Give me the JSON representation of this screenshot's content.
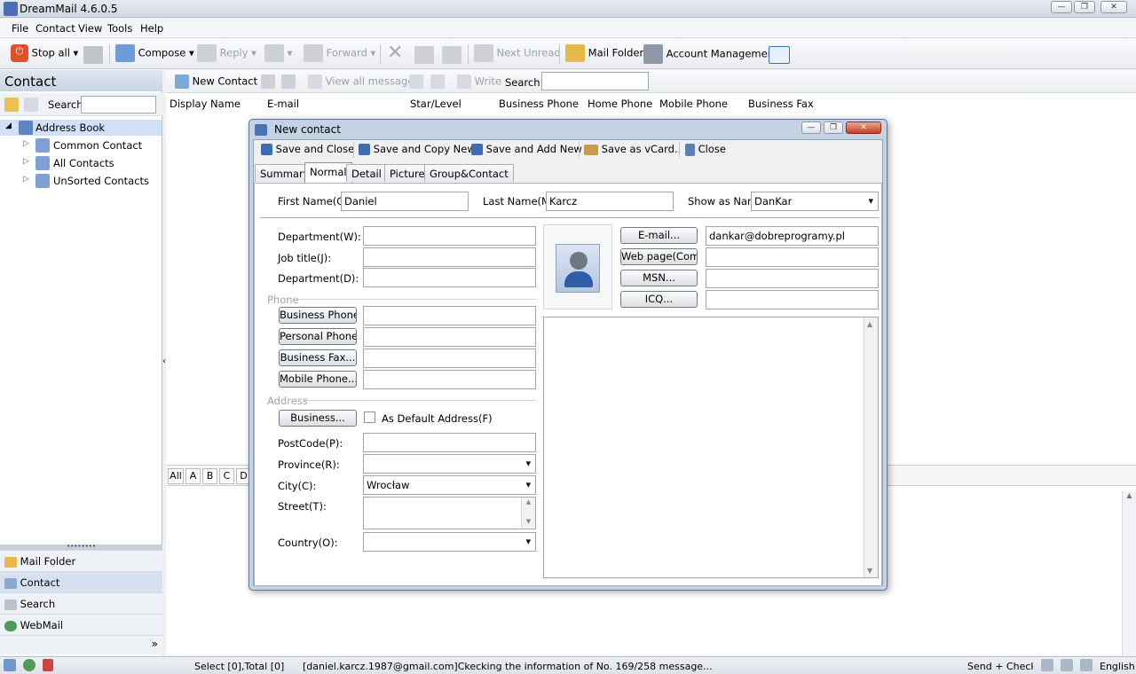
{
  "app": {
    "title": "DreamMail 4.6.0.5"
  },
  "menu": [
    "File",
    "Contact",
    "View",
    "Tools",
    "Help"
  ],
  "toolbar": {
    "stop_all": "Stop all",
    "compose": "Compose",
    "reply": "Reply",
    "forward": "Forward",
    "next_unread": "Next Unread",
    "mail_folder": "Mail Folder",
    "account_management": "Account Management"
  },
  "sidebar": {
    "title": "Contact",
    "search_label": "Search",
    "search_value": "",
    "tree": {
      "root": "Address Book",
      "items": [
        "Common Contact",
        "All Contacts",
        "UnSorted Contacts"
      ]
    },
    "nav": [
      "Mail Folder",
      "Contact",
      "Search",
      "WebMail"
    ]
  },
  "contacts_toolbar": {
    "new_contact": "New Contact",
    "view_all": "View all messages",
    "write": "Write",
    "search_label": "Search:",
    "search_value": ""
  },
  "columns": [
    "Display Name",
    "E-mail",
    "Star/Level",
    "Business Phone",
    "Home Phone",
    "Mobile Phone",
    "Business Fax"
  ],
  "alpha_tabs": [
    "All",
    "A",
    "B",
    "C",
    "D"
  ],
  "status": {
    "count": "Select [0],Total [0]",
    "message": "[daniel.karcz.1987@gmail.com]Ckecking the information of No. 169/258 message...",
    "send_check": "Send + Check..",
    "language": "English"
  },
  "dialog": {
    "title": "New contact",
    "buttons": {
      "save_close": "Save and Close",
      "save_copy_new": "Save and Copy New",
      "save_add_new": "Save and Add New",
      "save_vcard": "Save as vCard..",
      "close": "Close"
    },
    "tabs": [
      "Summary",
      "Normal",
      "Detail",
      "Picture",
      "Group&Contact"
    ],
    "first_name_label": "First Name(G)",
    "first_name": "Daniel",
    "last_name_label": "Last Name(M)",
    "last_name": "Karcz",
    "show_as_label": "Show as Name",
    "show_as": "DanKar",
    "department_w_label": "Department(W):",
    "department_w": "",
    "job_title_label": "Job title(J):",
    "job_title": "",
    "department_d_label": "Department(D):",
    "department_d": "",
    "phone_section": "Phone",
    "phone_buttons": [
      "Business Phone..",
      "Personal Phone..",
      "Business Fax...",
      "Mobile Phone..."
    ],
    "address_section": "Address",
    "business_btn": "Business...",
    "default_address_label": "As Default Address(F)",
    "default_address_checked": false,
    "postcode_label": "PostCode(P):",
    "postcode": "",
    "province_label": "Province(R):",
    "province": "",
    "city_label": "City(C):",
    "city": "Wrocław",
    "street_label": "Street(T):",
    "street": "",
    "country_label": "Country(O):",
    "country": "",
    "email_btn": "E-mail...",
    "email": "dankar@dobreprogramy.pl",
    "webpage_btn": "Web page(Company)",
    "webpage": "",
    "msn_btn": "MSN...",
    "msn": "",
    "icq_btn": "ICQ...",
    "icq": "",
    "notes": ""
  },
  "colors": {
    "accent": "#3a72c4",
    "tree_selected": "#cfe0f7",
    "dialog_frame": "#c4d2e3"
  }
}
